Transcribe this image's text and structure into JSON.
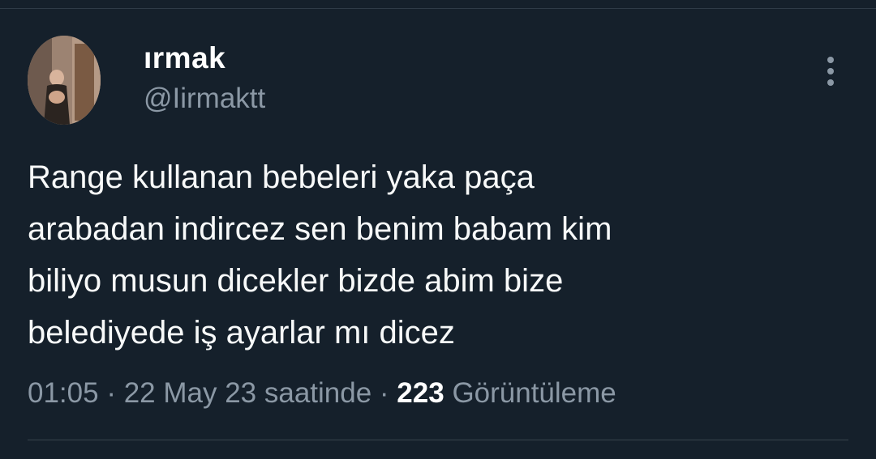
{
  "author": {
    "display_name": "ırmak",
    "handle": "@Iirmaktt"
  },
  "tweet": {
    "text": "Range  kullanan bebeleri yaka paça\narabadan indircez sen benim babam kim\nbiliyo musun dicekler bizde abim bize\nbelediyede iş ayarlar mı dicez"
  },
  "meta": {
    "time": "01:05",
    "separator": " · ",
    "date": "22 May 23 saatinde",
    "views_count": "223",
    "views_label": "Görüntüleme"
  },
  "icons": {
    "more": "more-vertical-icon"
  },
  "colors": {
    "background": "#15202b",
    "secondary_text": "#8b98a5",
    "primary_text": "#f7f9f9"
  }
}
